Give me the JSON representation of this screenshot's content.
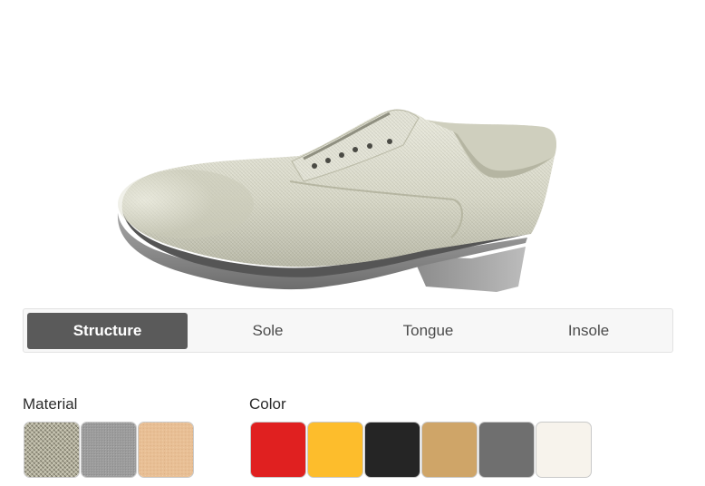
{
  "viewer": {
    "model": "shoe-3d-render"
  },
  "tabs": {
    "structure": "Structure",
    "sole": "Sole",
    "tongue": "Tongue",
    "insole": "Insole",
    "active": "structure"
  },
  "material": {
    "heading": "Material",
    "swatches": [
      {
        "name": "linen-texture",
        "color": "#a8a592"
      },
      {
        "name": "grey-fabric",
        "color": "#9a9a9a"
      },
      {
        "name": "beige-suede",
        "color": "#e7bd92"
      }
    ]
  },
  "color": {
    "heading": "Color",
    "swatches": [
      {
        "name": "red",
        "color": "#e02020"
      },
      {
        "name": "yellow",
        "color": "#fdbd2c"
      },
      {
        "name": "black",
        "color": "#252525"
      },
      {
        "name": "tan",
        "color": "#cfa568"
      },
      {
        "name": "grey",
        "color": "#6f6f6f"
      },
      {
        "name": "off-white",
        "color": "#f7f3ec"
      }
    ]
  }
}
